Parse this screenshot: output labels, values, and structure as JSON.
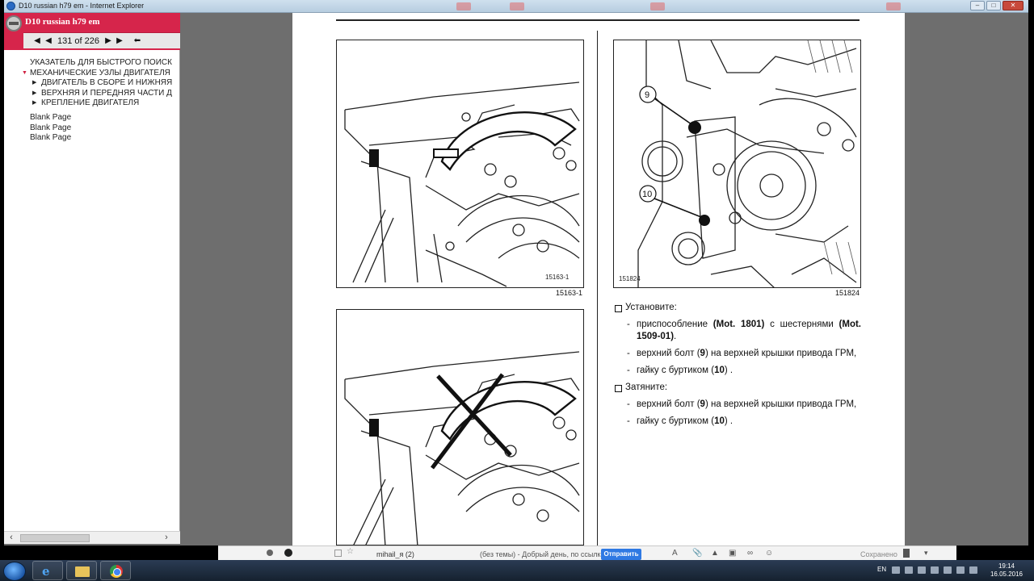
{
  "window": {
    "title": "D10 russian h79 em - Internet Explorer"
  },
  "nav": {
    "doc_title": "D10 russian h79 em",
    "page_info": "131 of 226",
    "first_icon": "first-page-icon",
    "prev_icon": "prev-page-icon",
    "next_icon": "next-page-icon",
    "last_icon": "last-page-icon",
    "back_icon": "back-icon",
    "tree": [
      {
        "label": "УКАЗАТЕЛЬ ДЛЯ БЫСТРОГО ПОИСК",
        "level": 0,
        "expanded": false
      },
      {
        "label": "МЕХАНИЧЕСКИЕ УЗЛЫ ДВИГАТЕЛЯ",
        "level": 0,
        "expanded": true
      },
      {
        "label": "ДВИГАТЕЛЬ В СБОРЕ И НИЖНЯЯ",
        "level": 1,
        "expanded": false
      },
      {
        "label": "ВЕРХНЯЯ И ПЕРЕДНЯЯ ЧАСТИ Д",
        "level": 1,
        "expanded": false
      },
      {
        "label": "КРЕПЛЕНИЕ ДВИГАТЕЛЯ",
        "level": 1,
        "expanded": false
      }
    ],
    "blank_pages": [
      "Blank Page",
      "Blank Page",
      "Blank Page"
    ]
  },
  "page": {
    "fig1_inner_label": "15163-1",
    "fig1_caption": "15163-1",
    "fig2_inner_label": "151824",
    "fig2_caption": "151824",
    "callout_9": "9",
    "callout_10": "10",
    "install_heading": "Установите:",
    "install_item1_pre": "приспособление ",
    "install_item1_b1": "(Mot. 1801)",
    "install_item1_mid": " с шестернями ",
    "install_item1_b2": "(Mot. 1509-01)",
    "install_item1_post": ".",
    "install_item2_pre": "верхний болт (",
    "install_item2_b": "9",
    "install_item2_post": ") на верхней крышки привода ГРМ,",
    "install_item3_pre": "гайку с буртиком (",
    "install_item3_b": "10",
    "install_item3_post": ") .",
    "tighten_heading": "Затяните:",
    "tighten_item1_pre": "верхний болт (",
    "tighten_item1_b": "9",
    "tighten_item1_post": ") на верхней крышки привода ГРМ,",
    "tighten_item2_pre": "гайку с буртиком (",
    "tighten_item2_b": "10",
    "tighten_item2_post": ") ."
  },
  "mailbar": {
    "sender": "mihail_я (2)",
    "subject": "(без темы) - Добрый день, по ссылке http://",
    "send_label": "Отправить",
    "saved_label": "Сохранено"
  },
  "taskbar": {
    "lang": "EN",
    "time": "19:14",
    "date": "16.05.2016"
  }
}
